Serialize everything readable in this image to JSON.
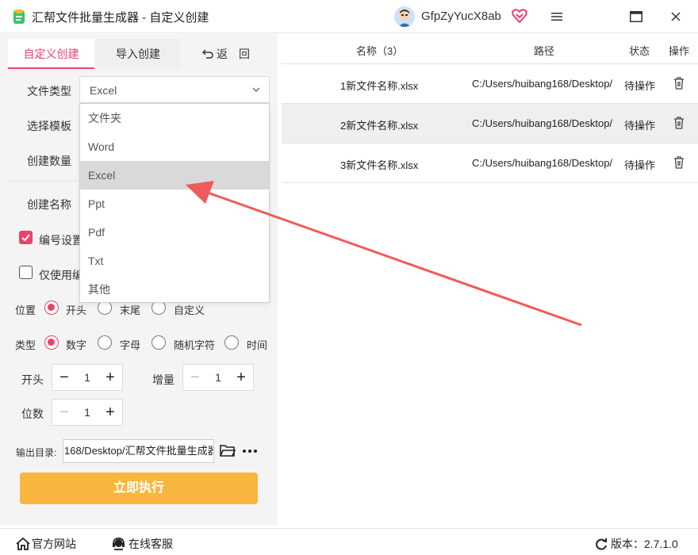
{
  "app": {
    "title": "汇帮文件批量生成器 - 自定义创建",
    "username": "GfpZyYucX8ab"
  },
  "tabs": {
    "custom": "自定义创建",
    "import": "导入创建",
    "back": "返　回"
  },
  "form": {
    "file_type_label": "文件类型",
    "file_type_value": "Excel",
    "template_label": "选择模板",
    "count_label": "创建数量",
    "name_label": "创建名称",
    "numbering_label": "编号设置",
    "numbering_checked": true,
    "only_label": "仅使用编",
    "only_checked": false
  },
  "dropdown": {
    "options": [
      "文件夹",
      "Word",
      "Excel",
      "Ppt",
      "Pdf",
      "Txt",
      "其他"
    ],
    "selected": "Excel"
  },
  "position": {
    "label": "位置",
    "options": [
      "开头",
      "末尾",
      "自定义"
    ],
    "selected": "开头"
  },
  "type": {
    "label": "类型",
    "options": [
      "数字",
      "字母",
      "随机字符",
      "时间"
    ],
    "selected": "数字"
  },
  "start": {
    "label": "开头",
    "value": "1"
  },
  "increment": {
    "label": "增量",
    "value": "1"
  },
  "digits": {
    "label": "位数",
    "value": "1"
  },
  "output": {
    "label": "输出目录:",
    "path": "168/Desktop/汇帮文件批量生成器"
  },
  "run_button": "立即执行",
  "table": {
    "headers": {
      "name": "名称（3）",
      "path": "路径",
      "status": "状态",
      "action": "操作"
    },
    "rows": [
      {
        "name": "1新文件名称.xlsx",
        "path": "C:/Users/huibang168/Desktop/",
        "status": "待操作"
      },
      {
        "name": "2新文件名称.xlsx",
        "path": "C:/Users/huibang168/Desktop/",
        "status": "待操作"
      },
      {
        "name": "3新文件名称.xlsx",
        "path": "C:/Users/huibang168/Desktop/",
        "status": "待操作"
      }
    ]
  },
  "bottom": {
    "website": "官方网站",
    "support": "在线客服",
    "version": "版本：2.7.1.0"
  },
  "colors": {
    "accent": "#e9436b",
    "button": "#f8b63f",
    "arrow": "#f05a5a"
  },
  "icons": [
    "app-logo-icon",
    "avatar-icon",
    "vip-heart-icon",
    "menu-icon",
    "maximize-icon",
    "close-icon",
    "undo-icon",
    "chevron-down-icon",
    "folder-icon",
    "more-icon",
    "trash-icon",
    "home-icon",
    "headset-icon",
    "refresh-icon"
  ]
}
